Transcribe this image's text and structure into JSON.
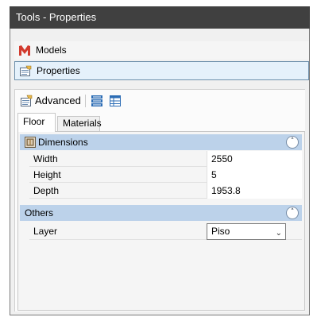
{
  "window": {
    "title": "Tools - Properties"
  },
  "nav": {
    "models_label": "Models",
    "properties_label": "Properties"
  },
  "toolbar": {
    "advanced_label": "Advanced"
  },
  "tabs": [
    {
      "label": "Floor",
      "active": true
    },
    {
      "label": "Materials",
      "active": false
    }
  ],
  "groups": {
    "dimensions": {
      "title": "Dimensions",
      "rows": [
        {
          "name": "Width",
          "value": "2550"
        },
        {
          "name": "Height",
          "value": "5"
        },
        {
          "name": "Depth",
          "value": "1953.8"
        }
      ]
    },
    "others": {
      "title": "Others",
      "rows": [
        {
          "name": "Layer",
          "value": "Piso"
        }
      ]
    }
  },
  "icons": {
    "models": "models-logo-icon",
    "properties": "properties-icon",
    "advanced": "advanced-properties-icon",
    "categorized": "categorized-view-icon",
    "alphabetical": "table-view-icon",
    "dimensions": "dimensions-icon",
    "collapse": "collapse-icon",
    "dropdown": "chevron-down-icon"
  },
  "colors": {
    "titlebar": "#404040",
    "group_header": "#bcd2ea",
    "selected_nav": "#e5f1fb",
    "models_logo": "#d23b2e"
  }
}
